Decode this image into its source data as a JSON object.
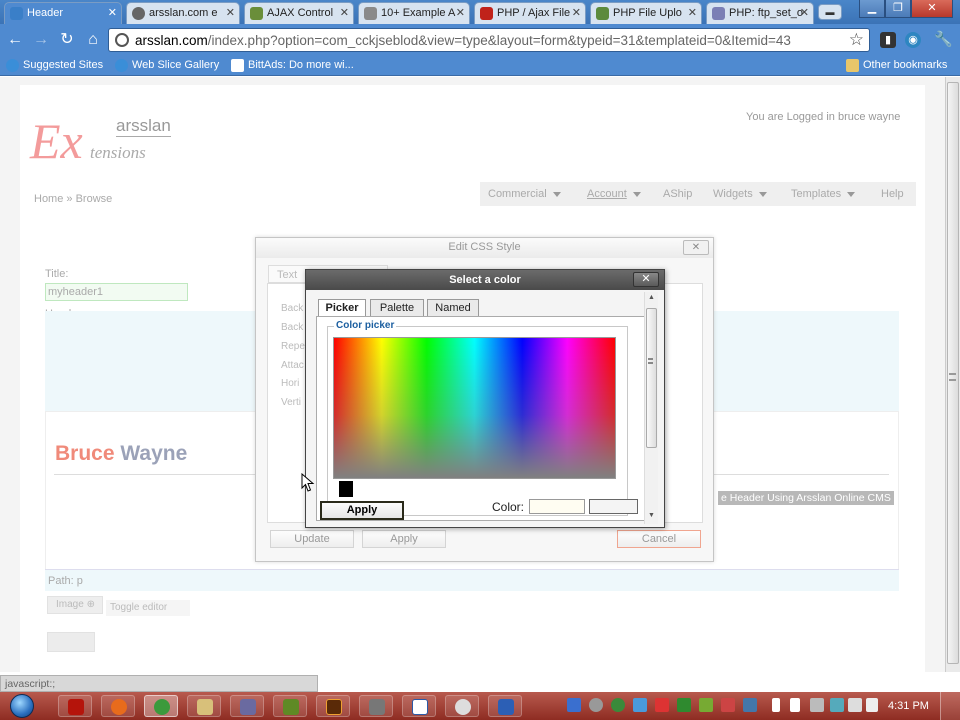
{
  "browser": {
    "tabs": [
      {
        "label": "Header",
        "active": true
      },
      {
        "label": "arsslan.com e"
      },
      {
        "label": "AJAX Control"
      },
      {
        "label": "10+ Example A"
      },
      {
        "label": "PHP / Ajax File"
      },
      {
        "label": "PHP File Uplo"
      },
      {
        "label": "PHP: ftp_set_o"
      }
    ],
    "url_domain": "arsslan.com",
    "url_rest": "/index.php?option=com_cckjseblod&view=type&layout=form&typeid=31&templateid=0&Itemid=43",
    "bookmarks": [
      "Suggested Sites",
      "Web Slice Gallery",
      "BittAds: Do more wi...",
      "Other bookmarks"
    ]
  },
  "site": {
    "logo_ex": "Ex",
    "logo_top": "arsslan",
    "logo_bottom": "tensions",
    "logged_in": "You are Logged in   bruce wayne",
    "breadcrumb": "Home »  Browse",
    "menu": [
      "Commercial",
      "Account",
      "AShip",
      "Widgets",
      "Templates",
      "Help"
    ]
  },
  "form": {
    "title_label": "Title:",
    "title_value": "myheader1",
    "header_label": "Header:",
    "preview_first": "Bruce",
    "preview_last": "Wayne",
    "preview_tagline": "e Header Using Arsslan Online CMS",
    "path": "Path: p",
    "image_btn": "Image",
    "toggle_btn": "Toggle editor"
  },
  "edit_css": {
    "title": "Edit CSS Style",
    "tab": "Text",
    "labels": [
      "Back",
      "Back",
      "Repe",
      "Attac",
      "Hori",
      "Verti"
    ],
    "update": "Update",
    "apply": "Apply",
    "cancel": "Cancel"
  },
  "picker": {
    "title": "Select a color",
    "tabs": [
      "Picker",
      "Palette",
      "Named"
    ],
    "legend": "Color picker",
    "apply": "Apply",
    "color_label": "Color:",
    "color_value": ""
  },
  "status_text": "javascript:;",
  "clock": "4:31 PM"
}
